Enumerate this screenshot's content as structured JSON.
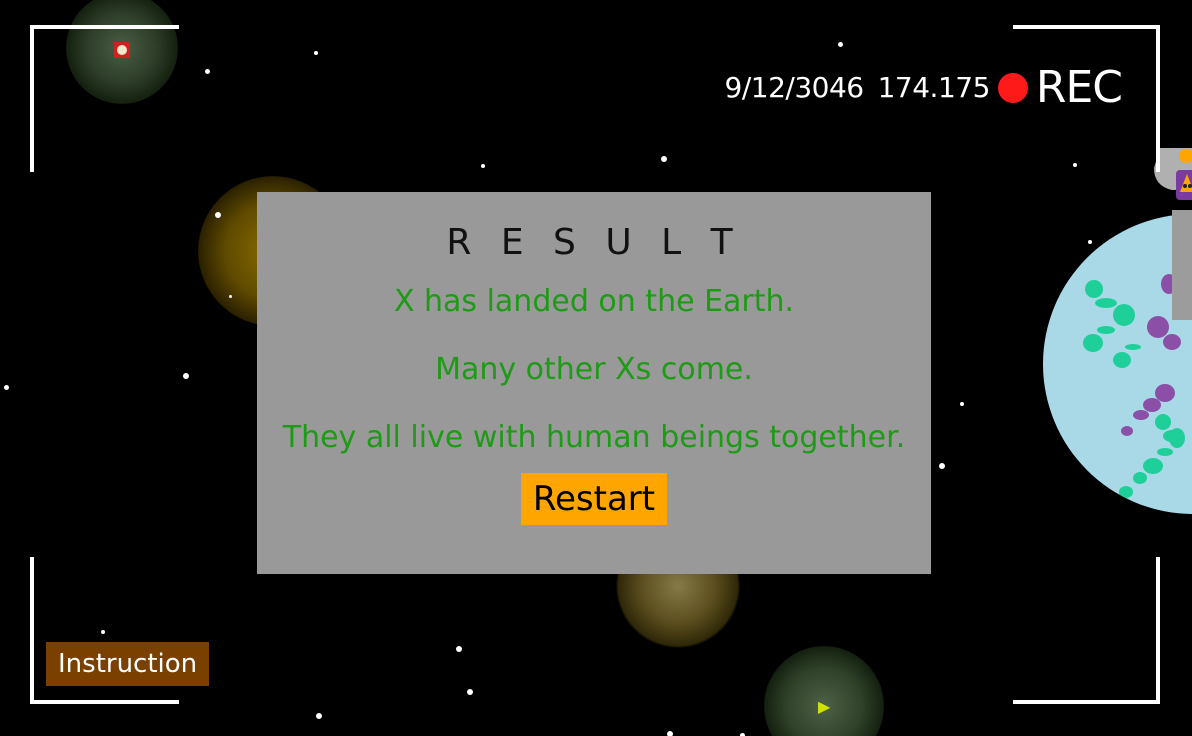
{
  "hud": {
    "date": "9/12/3046",
    "time": "174.175",
    "rec_label": "REC",
    "rec_color": "#ff1a1a"
  },
  "result_panel": {
    "title": "R E S U L T",
    "lines": [
      "X has landed on the Earth.",
      "Many other Xs come.",
      "They all live with human beings together."
    ],
    "restart_label": "Restart"
  },
  "instruction_label": "Instruction",
  "icons": {
    "top_left": "stop-icon",
    "bottom_center": "play-icon"
  },
  "colors": {
    "background": "#000000",
    "panel": "#999999",
    "panel_text": "#1f9a16",
    "restart_button": "#ffa500",
    "instruction_button": "#7a4000",
    "earth": "#a9d9e6"
  }
}
